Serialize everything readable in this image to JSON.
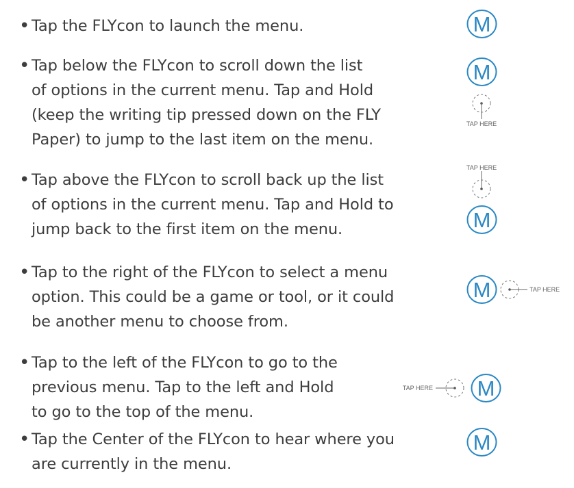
{
  "instructions": [
    {
      "lines": [
        "Tap the FLYcon to launch the menu."
      ]
    },
    {
      "lines": [
        "Tap below the FLYcon to scroll down the list",
        "of options in the current menu. Tap and Hold",
        "(keep the writing tip pressed down on the FLY",
        "Paper) to jump to the last item on the menu."
      ]
    },
    {
      "lines": [
        "Tap above the FLYcon to scroll back up the list",
        "of options in the current menu. Tap and Hold to",
        "jump back to the first item on the menu."
      ]
    },
    {
      "lines": [
        "Tap to the right of the FLYcon to select a menu",
        "option. This could be a game or tool, or it could",
        "be another menu to choose from."
      ]
    },
    {
      "lines": [
        "Tap to the left of the FLYcon to go to the",
        "previous menu. Tap to the left and Hold",
        "to go to the top of the menu."
      ]
    },
    {
      "lines": [
        "Tap the Center of the FLYcon to hear where you",
        "are currently in the menu."
      ]
    }
  ],
  "bullet": "•",
  "flycon_letter": "M",
  "tap_label": "TAP HERE",
  "colors": {
    "flycon": "#2a88c4",
    "text": "#3d3d3d",
    "tap_marker": "#777777"
  }
}
